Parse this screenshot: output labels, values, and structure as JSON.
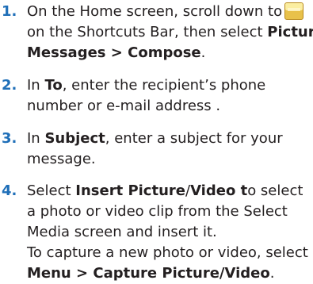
{
  "steps": [
    {
      "number": "1.",
      "l1": "On the Home screen, scroll down to",
      "l2": "on the Shortcuts Bar, then select",
      "l2b": "Picture",
      "l3a": "Messages > Compose",
      "l3b": "."
    },
    {
      "number": "2.",
      "l1a": "In",
      "l1b": "To",
      "l1c": ", enter the recipient’s phone",
      "l2": "number or e-mail address ."
    },
    {
      "number": "3.",
      "l1a": "In",
      "l1b": "Subject",
      "l1c": ", enter a subject for your",
      "l2": "message."
    },
    {
      "number": "4.",
      "l1a": "Select",
      "l1b": "Insert Picture",
      "l1c": "/",
      "l1d": "Video t",
      "l1e": "o select",
      "l2": "a photo or video clip from the Select",
      "l3": "Media screen and insert it.",
      "l4": "To capture a new photo or video, select",
      "l5a": "Menu > Capture Picture/Video",
      "l5b": "."
    }
  ],
  "icon": {
    "name": "picture-messages-icon",
    "color_top": "#f7e27a",
    "color_body": "#d4a62a"
  }
}
